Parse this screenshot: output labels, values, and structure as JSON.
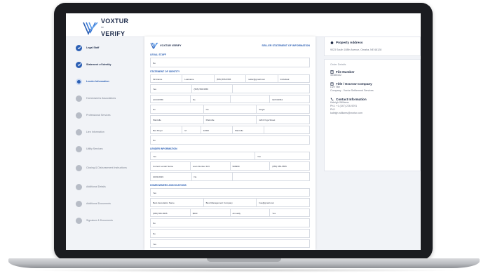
{
  "brand": {
    "line1": "VOXTUR",
    "tm": "™",
    "line2": "VERIFY"
  },
  "steps": [
    {
      "label": "Legal Staff",
      "state": "done"
    },
    {
      "label": "Statement of Identity",
      "state": "done"
    },
    {
      "label": "Lender Information",
      "state": "active"
    },
    {
      "label": "Homeowners Associations",
      "state": "todo"
    },
    {
      "label": "Professional Services",
      "state": "todo"
    },
    {
      "label": "Lien Information",
      "state": "todo"
    },
    {
      "label": "Utility Services",
      "state": "todo"
    },
    {
      "label": "Closing & Disbursement Instructions",
      "state": "todo"
    },
    {
      "label": "Additional Details",
      "state": "todo"
    },
    {
      "label": "Additional Documents",
      "state": "todo"
    },
    {
      "label": "Signature & Documents",
      "state": "todo"
    }
  ],
  "document": {
    "brand": "VOXTUR VERIFY",
    "title": "SELLER STATEMENT OF INFORMATION",
    "sections": {
      "legal": "LEGAL STAFF",
      "identity": "STATEMENT OF IDENTITY",
      "lender": "LENDER INFORMATION",
      "hoa": "HOMEOWNERS ASSOCIATIONS"
    },
    "values": {
      "legal_answer": "No",
      "first_name": "Firstname",
      "last_name": "Lastname",
      "phone": "(555) 555-5555",
      "email": "seller@gmail.com",
      "status": "Individual",
      "yes_no_1": "Yes",
      "phone_2": "(555) 555-5555",
      "account": "ACC00789",
      "no_1": "No",
      "date_1": "02/13/1961",
      "no_2": "No",
      "no_3": "No",
      "single": "Single",
      "city_1": "Plainville",
      "city_2": "Plainville",
      "address_1": "1234 Yoga Street",
      "name_1": "Ben Buyer",
      "m": "M",
      "zip": "12000",
      "city_3": "Plainville",
      "no_4": "No",
      "lender_q1": "Yes",
      "lender_q2": "Yes",
      "lender_name": "Current Lender Name",
      "loan_num": "Loan Number 123",
      "acct_2": "999999",
      "lender_phone": "(555) 555-5555",
      "date_2": "10/01/2019",
      "no_5": "No",
      "hoa_q1": "Yes",
      "hoa_name": "Best Association Name",
      "hoa_mgmt": "Best Management Company",
      "hoa_email": "hoa@gmail.com",
      "hoa_phone": "(555) 555-5555",
      "hoa_fee": "$500",
      "hoa_freq": "Annually",
      "hoa_yes": "Yes",
      "no_6": "No",
      "no_7": "No",
      "no_8": "Yes"
    }
  },
  "property": {
    "title": "Property Address",
    "address": "9023 South 108th Avenue, Omaha, NE 68128"
  },
  "order": {
    "heading": "Order Details",
    "file_title": "File Number",
    "file_number": "45485432",
    "company_title": "Title / Escrow Company",
    "company_line1": "Live Title",
    "company_line2": "Company - Voxtur Settlement Services",
    "contact_title": "Contact Information",
    "contact_name": "Kaleigh Williams",
    "contact_phone": "Ph1: +1 (347) 226-9291",
    "contact_ph2": "Ph2:",
    "contact_email": "kaleigh.williams@voxtur.com"
  }
}
